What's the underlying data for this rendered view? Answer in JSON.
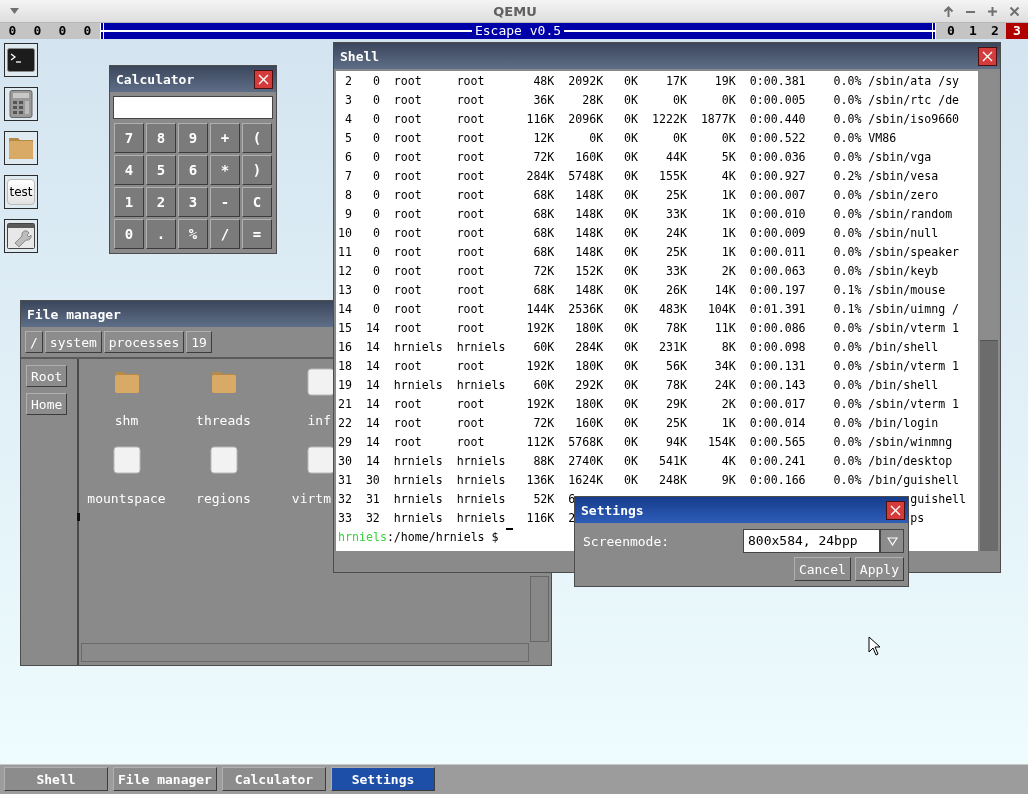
{
  "qemu": {
    "title": "QEMU"
  },
  "escape_bar": {
    "counters": [
      "0",
      "0",
      "0",
      "0"
    ],
    "title": "Escape v0.5",
    "workspaces": [
      {
        "label": "0",
        "selected": false
      },
      {
        "label": "1",
        "selected": false
      },
      {
        "label": "2",
        "selected": false
      },
      {
        "label": "3",
        "selected": true
      }
    ]
  },
  "desktop_icons": [
    {
      "kind": "terminal"
    },
    {
      "kind": "calculator"
    },
    {
      "kind": "folder"
    },
    {
      "kind": "text",
      "label": "test"
    },
    {
      "kind": "settings"
    }
  ],
  "calculator": {
    "title": "Calculator",
    "active": false,
    "keys": [
      "7",
      "8",
      "9",
      "+",
      "(",
      "4",
      "5",
      "6",
      "*",
      ")",
      "1",
      "2",
      "3",
      "-",
      "C",
      "0",
      ".",
      "%",
      "/",
      "="
    ]
  },
  "file_manager": {
    "title": "File manager",
    "active": false,
    "path": [
      "/",
      "system",
      "processes",
      "19"
    ],
    "places": [
      "Root",
      "Home"
    ],
    "items": [
      {
        "name": "shm",
        "kind": "folder"
      },
      {
        "name": "threads",
        "kind": "folder"
      },
      {
        "name": "inf",
        "kind": "file"
      },
      {
        "name": "mountspace",
        "kind": "file"
      },
      {
        "name": "regions",
        "kind": "file"
      },
      {
        "name": "virtm",
        "kind": "file"
      }
    ]
  },
  "shell": {
    "title": "Shell",
    "active": false,
    "rows": [
      {
        "cells": [
          "2",
          "0",
          "root",
          "root",
          "48K",
          "2092K",
          "0K",
          "17K",
          "19K",
          "0:00.381",
          "0.0%",
          "/sbin/ata /sy"
        ]
      },
      {
        "cells": [
          "3",
          "0",
          "root",
          "root",
          "36K",
          "28K",
          "0K",
          "0K",
          "0K",
          "0:00.005",
          "0.0%",
          "/sbin/rtc /de"
        ]
      },
      {
        "cells": [
          "4",
          "0",
          "root",
          "root",
          "116K",
          "2096K",
          "0K",
          "1222K",
          "1877K",
          "0:00.440",
          "0.0%",
          "/sbin/iso9660"
        ]
      },
      {
        "cells": [
          "5",
          "0",
          "root",
          "root",
          "12K",
          "0K",
          "0K",
          "0K",
          "0K",
          "0:00.522",
          "0.0%",
          "VM86"
        ]
      },
      {
        "cells": [
          "6",
          "0",
          "root",
          "root",
          "72K",
          "160K",
          "0K",
          "44K",
          "5K",
          "0:00.036",
          "0.0%",
          "/sbin/vga"
        ]
      },
      {
        "cells": [
          "7",
          "0",
          "root",
          "root",
          "284K",
          "5748K",
          "0K",
          "155K",
          "4K",
          "0:00.927",
          "0.2%",
          "/sbin/vesa"
        ]
      },
      {
        "cells": [
          "8",
          "0",
          "root",
          "root",
          "68K",
          "148K",
          "0K",
          "25K",
          "1K",
          "0:00.007",
          "0.0%",
          "/sbin/zero"
        ]
      },
      {
        "cells": [
          "9",
          "0",
          "root",
          "root",
          "68K",
          "148K",
          "0K",
          "33K",
          "1K",
          "0:00.010",
          "0.0%",
          "/sbin/random"
        ]
      },
      {
        "cells": [
          "10",
          "0",
          "root",
          "root",
          "68K",
          "148K",
          "0K",
          "24K",
          "1K",
          "0:00.009",
          "0.0%",
          "/sbin/null"
        ]
      },
      {
        "cells": [
          "11",
          "0",
          "root",
          "root",
          "68K",
          "148K",
          "0K",
          "25K",
          "1K",
          "0:00.011",
          "0.0%",
          "/sbin/speaker"
        ]
      },
      {
        "cells": [
          "12",
          "0",
          "root",
          "root",
          "72K",
          "152K",
          "0K",
          "33K",
          "2K",
          "0:00.063",
          "0.0%",
          "/sbin/keyb"
        ]
      },
      {
        "cells": [
          "13",
          "0",
          "root",
          "root",
          "68K",
          "148K",
          "0K",
          "26K",
          "14K",
          "0:00.197",
          "0.1%",
          "/sbin/mouse"
        ]
      },
      {
        "cells": [
          "14",
          "0",
          "root",
          "root",
          "144K",
          "2536K",
          "0K",
          "483K",
          "104K",
          "0:01.391",
          "0.1%",
          "/sbin/uimng /"
        ]
      },
      {
        "cells": [
          "15",
          "14",
          "root",
          "root",
          "192K",
          "180K",
          "0K",
          "78K",
          "11K",
          "0:00.086",
          "0.0%",
          "/sbin/vterm 1"
        ]
      },
      {
        "cells": [
          "16",
          "14",
          "hrniels",
          "hrniels",
          "60K",
          "284K",
          "0K",
          "231K",
          "8K",
          "0:00.098",
          "0.0%",
          "/bin/shell"
        ]
      },
      {
        "cells": [
          "18",
          "14",
          "root",
          "root",
          "192K",
          "180K",
          "0K",
          "56K",
          "34K",
          "0:00.131",
          "0.0%",
          "/sbin/vterm 1"
        ]
      },
      {
        "cells": [
          "19",
          "14",
          "hrniels",
          "hrniels",
          "60K",
          "292K",
          "0K",
          "78K",
          "24K",
          "0:00.143",
          "0.0%",
          "/bin/shell"
        ]
      },
      {
        "cells": [
          "21",
          "14",
          "root",
          "root",
          "192K",
          "180K",
          "0K",
          "29K",
          "2K",
          "0:00.017",
          "0.0%",
          "/sbin/vterm 1"
        ]
      },
      {
        "cells": [
          "22",
          "14",
          "root",
          "root",
          "72K",
          "160K",
          "0K",
          "25K",
          "1K",
          "0:00.014",
          "0.0%",
          "/bin/login"
        ]
      },
      {
        "cells": [
          "29",
          "14",
          "root",
          "root",
          "112K",
          "5768K",
          "0K",
          "94K",
          "154K",
          "0:00.565",
          "0.0%",
          "/sbin/winmng"
        ]
      },
      {
        "cells": [
          "30",
          "14",
          "hrniels",
          "hrniels",
          "88K",
          "2740K",
          "0K",
          "541K",
          "4K",
          "0:00.241",
          "0.0%",
          "/bin/desktop"
        ]
      },
      {
        "cells": [
          "31",
          "30",
          "hrniels",
          "hrniels",
          "136K",
          "1624K",
          "0K",
          "248K",
          "9K",
          "0:00.166",
          "0.0%",
          "/bin/guishell"
        ]
      },
      {
        "cells": [
          "32",
          "31",
          "hrniels",
          "hrniels",
          "52K",
          "6"
        ],
        "tail": "guishell"
      },
      {
        "cells": [
          "33",
          "32",
          "hrniels",
          "hrniels",
          "116K",
          "2"
        ],
        "tail": "ps"
      }
    ],
    "prompt": {
      "user": "hrniels",
      "path": ":/home/hrniels $"
    }
  },
  "settings": {
    "title": "Settings",
    "active": true,
    "label": "Screenmode:",
    "value": "800x584, 24bpp",
    "buttons": [
      "Cancel",
      "Apply"
    ]
  },
  "taskbar": [
    {
      "label": "Shell",
      "selected": false
    },
    {
      "label": "File manager",
      "selected": false
    },
    {
      "label": "Calculator",
      "selected": false
    },
    {
      "label": "Settings",
      "selected": true
    }
  ]
}
